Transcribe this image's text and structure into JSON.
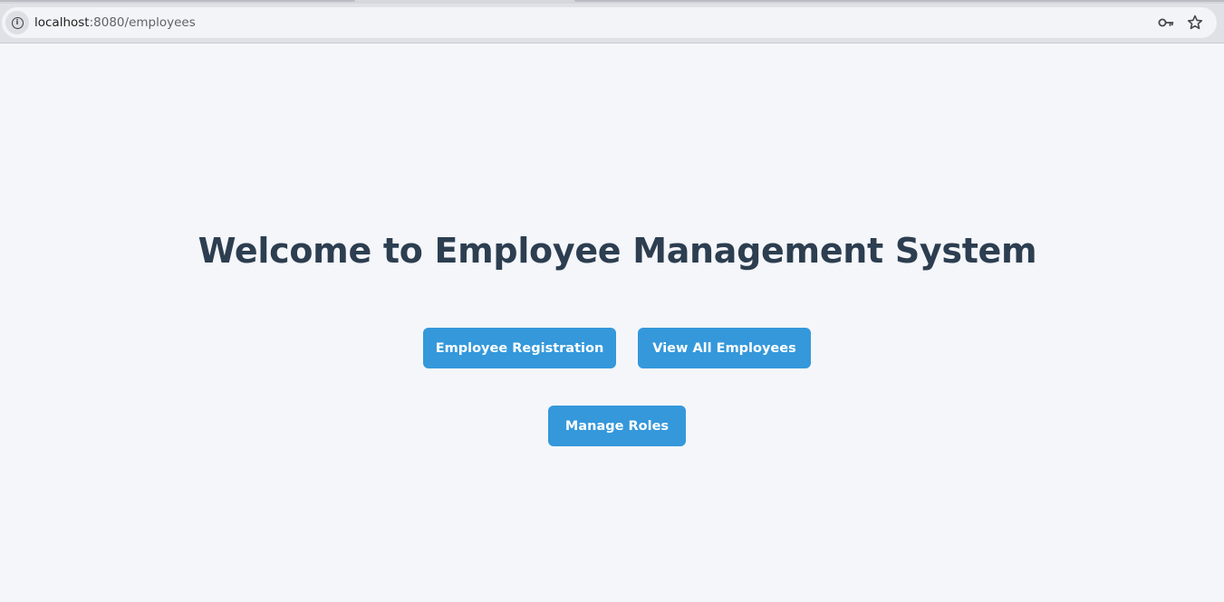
{
  "browser": {
    "url_host": "localhost",
    "url_path": ":8080/employees",
    "site_info_icon": "info-icon",
    "password_icon": "key-icon",
    "bookmark_icon": "star-icon"
  },
  "main": {
    "title": "Welcome to Employee Management System",
    "buttons": {
      "registration": "Employee Registration",
      "view_all": "View All Employees",
      "manage_roles": "Manage Roles"
    }
  },
  "colors": {
    "background": "#f5f6fa",
    "title": "#2c3e50",
    "button": "#3498db",
    "button_text": "#ffffff"
  }
}
